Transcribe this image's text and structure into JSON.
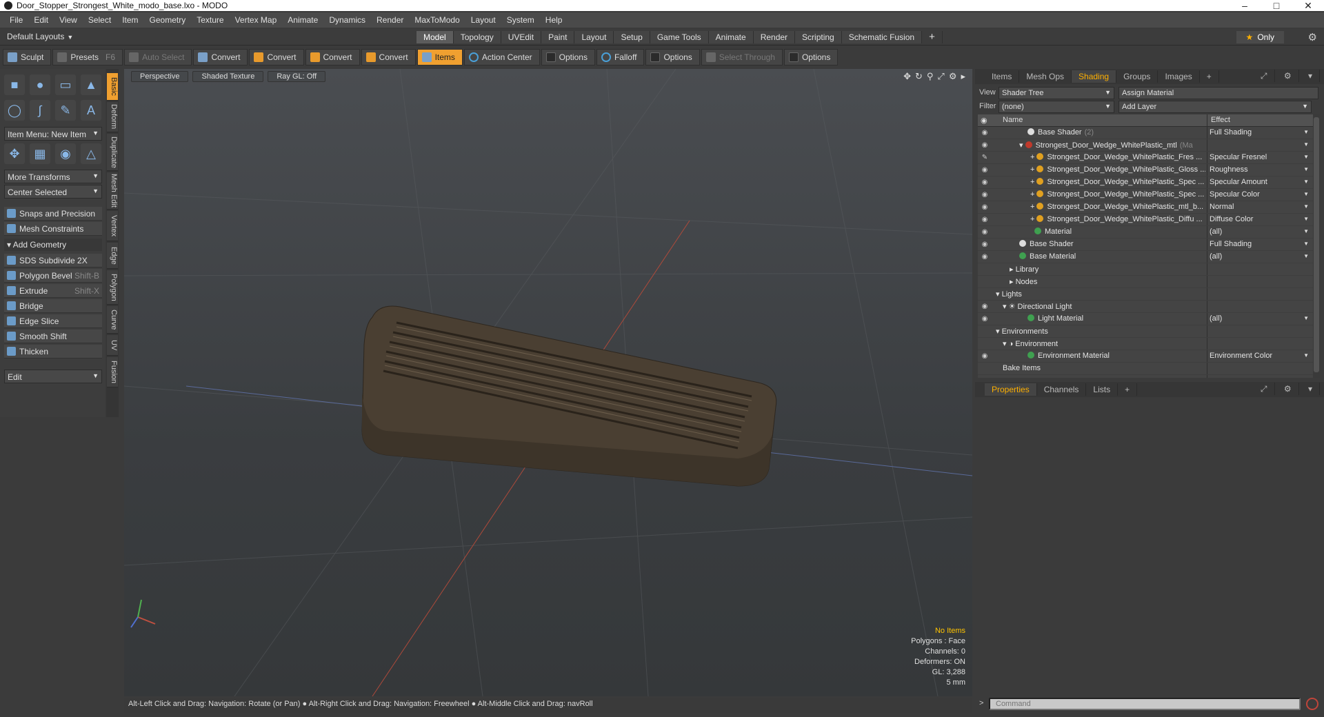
{
  "window": {
    "title": "Door_Stopper_Strongest_White_modo_base.lxo - MODO"
  },
  "menu": [
    "File",
    "Edit",
    "View",
    "Select",
    "Item",
    "Geometry",
    "Texture",
    "Vertex Map",
    "Animate",
    "Dynamics",
    "Render",
    "MaxToModo",
    "Layout",
    "System",
    "Help"
  ],
  "layoutbar": {
    "layout_select": "Default Layouts",
    "tabs": [
      "Model",
      "Topology",
      "UVEdit",
      "Paint",
      "Layout",
      "Setup",
      "Game Tools",
      "Animate",
      "Render",
      "Scripting",
      "Schematic Fusion"
    ],
    "active_tab": "Model",
    "only_label": "Only"
  },
  "toolbar": {
    "sculpt": "Sculpt",
    "presets": "Presets",
    "presets_key": "F6",
    "auto_select": "Auto Select",
    "convert1": "Convert",
    "convert2": "Convert",
    "convert3": "Convert",
    "convert4": "Convert",
    "items": "Items",
    "action_center": "Action Center",
    "options1": "Options",
    "falloff": "Falloff",
    "options2": "Options",
    "select_through": "Select Through",
    "options3": "Options"
  },
  "left": {
    "item_menu": "Item Menu: New Item",
    "more_transforms": "More Transforms",
    "center_selected": "Center Selected",
    "snaps": "Snaps and Precision",
    "constraints": "Mesh Constraints",
    "add_geometry": "Add Geometry",
    "tools": [
      {
        "label": "SDS Subdivide 2X",
        "key": ""
      },
      {
        "label": "Polygon Bevel",
        "key": "Shift-B"
      },
      {
        "label": "Extrude",
        "key": "Shift-X"
      },
      {
        "label": "Bridge",
        "key": ""
      },
      {
        "label": "Edge Slice",
        "key": ""
      },
      {
        "label": "Smooth Shift",
        "key": ""
      },
      {
        "label": "Thicken",
        "key": ""
      }
    ],
    "edit_menu": "Edit",
    "vtabs": [
      "Basic",
      "Deform",
      "Duplicate",
      "Mesh Edit",
      "Vertex",
      "Edge",
      "Polygon",
      "Curve",
      "UV",
      "Fusion"
    ]
  },
  "viewport": {
    "view": "Perspective",
    "shading": "Shaded Texture",
    "raygl": "Ray GL: Off",
    "stats": {
      "no_items": "No Items",
      "polygons": "Polygons : Face",
      "channels": "Channels: 0",
      "deformers": "Deformers: ON",
      "gl": "GL: 3,288",
      "scale": "5 mm"
    }
  },
  "statusbar": "Alt-Left Click and Drag: Navigation: Rotate (or Pan) ●  Alt-Right Click and Drag: Navigation: Freewheel ●  Alt-Middle Click and Drag: navRoll",
  "right": {
    "tabs": [
      "Items",
      "Mesh Ops",
      "Shading",
      "Groups",
      "Images"
    ],
    "active_tab": "Shading",
    "view_label": "View",
    "view_value": "Shader Tree",
    "assign_material": "Assign Material",
    "filter_label": "Filter",
    "filter_value": "(none)",
    "add_layer": "Add Layer",
    "col_name": "Name",
    "col_effect": "Effect",
    "rows": [
      {
        "name": "Base Shader",
        "count": "(2)",
        "effect": "Full Shading"
      },
      {
        "name": "Strongest_Door_Wedge_WhitePlastic_mtl",
        "count": "(Ma",
        "effect": ""
      },
      {
        "name": "Strongest_Door_Wedge_WhitePlastic_Fres ...",
        "count": "",
        "effect": "Specular Fresnel"
      },
      {
        "name": "Strongest_Door_Wedge_WhitePlastic_Gloss ...",
        "count": "",
        "effect": "Roughness"
      },
      {
        "name": "Strongest_Door_Wedge_WhitePlastic_Spec ...",
        "count": "",
        "effect": "Specular Amount"
      },
      {
        "name": "Strongest_Door_Wedge_WhitePlastic_Spec ...",
        "count": "",
        "effect": "Specular Color"
      },
      {
        "name": "Strongest_Door_Wedge_WhitePlastic_mtl_b...",
        "count": "",
        "effect": "Normal"
      },
      {
        "name": "Strongest_Door_Wedge_WhitePlastic_Diffu ...",
        "count": "",
        "effect": "Diffuse Color"
      },
      {
        "name": "Material",
        "count": "",
        "effect": "(all)"
      },
      {
        "name": "Base Shader",
        "count": "",
        "effect": "Full Shading"
      },
      {
        "name": "Base Material",
        "count": "",
        "effect": "(all)"
      },
      {
        "name": "Library",
        "count": "",
        "effect": ""
      },
      {
        "name": "Nodes",
        "count": "",
        "effect": ""
      },
      {
        "name": "Lights",
        "count": "",
        "effect": ""
      },
      {
        "name": "Directional Light",
        "count": "",
        "effect": ""
      },
      {
        "name": "Light Material",
        "count": "",
        "effect": "(all)"
      },
      {
        "name": "Environments",
        "count": "",
        "effect": ""
      },
      {
        "name": "Environment",
        "count": "",
        "effect": ""
      },
      {
        "name": "Environment Material",
        "count": "",
        "effect": "Environment Color"
      },
      {
        "name": "Bake Items",
        "count": "",
        "effect": ""
      }
    ],
    "ptabs": [
      "Properties",
      "Channels",
      "Lists"
    ],
    "active_ptab": "Properties",
    "command_placeholder": "Command"
  },
  "colors": {
    "accent": "#f0a030",
    "model_color": "#4a3f32"
  }
}
